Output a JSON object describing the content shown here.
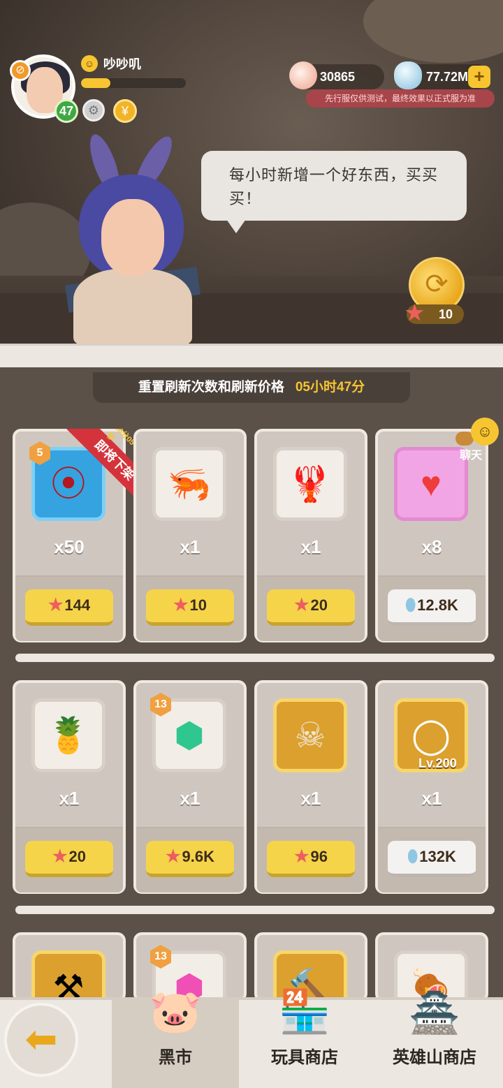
{
  "player": {
    "name": "吵吵叽",
    "level": "47",
    "xp_progress": 0.28
  },
  "resources": {
    "shells": "30865",
    "gems": "77.72M",
    "notice": "先行服仅供测试，最终效果以正式服为准"
  },
  "npc": {
    "speech": "每小时新增一个好东西，买买买！"
  },
  "refresh": {
    "cost": "10"
  },
  "timer": {
    "label": "重置刷新次数和刷新价格",
    "time": "05小时47分"
  },
  "chat": {
    "label": "聊天"
  },
  "shop": {
    "row1": [
      {
        "icon": "claw-scratch-icon",
        "qty": "x50",
        "price": "144",
        "currency": "star",
        "badge": "5",
        "ribbon": "即将下架",
        "ribbon_sub": "56分05秒"
      },
      {
        "icon": "shrimp-icon",
        "qty": "x1",
        "price": "10",
        "currency": "star"
      },
      {
        "icon": "lobster-icon",
        "qty": "x1",
        "price": "20",
        "currency": "star"
      },
      {
        "icon": "heart-plus-icon",
        "qty": "x8",
        "price": "12.8K",
        "currency": "gem"
      }
    ],
    "row2": [
      {
        "icon": "pineapple-icon",
        "qty": "x1",
        "price": "20",
        "currency": "star"
      },
      {
        "icon": "green-crystal-icon",
        "qty": "x1",
        "price": "9.6K",
        "currency": "star",
        "badge": "13"
      },
      {
        "icon": "fossil-skull-icon",
        "qty": "x1",
        "price": "96",
        "currency": "star"
      },
      {
        "icon": "bone-necklace-icon",
        "qty": "x1",
        "price": "132K",
        "currency": "gem",
        "lv": "Lv.200"
      }
    ],
    "row3_badge": "13"
  },
  "nav": {
    "tabs": [
      {
        "label": "黑市",
        "active": true
      },
      {
        "label": "玩具商店",
        "active": false
      },
      {
        "label": "英雄山商店",
        "active": false
      }
    ]
  },
  "colors": {
    "gold": "#f6c531",
    "price_yellow": "#f6d44a",
    "ribbon_red": "#d4333b",
    "notice_red": "#a7454a"
  }
}
